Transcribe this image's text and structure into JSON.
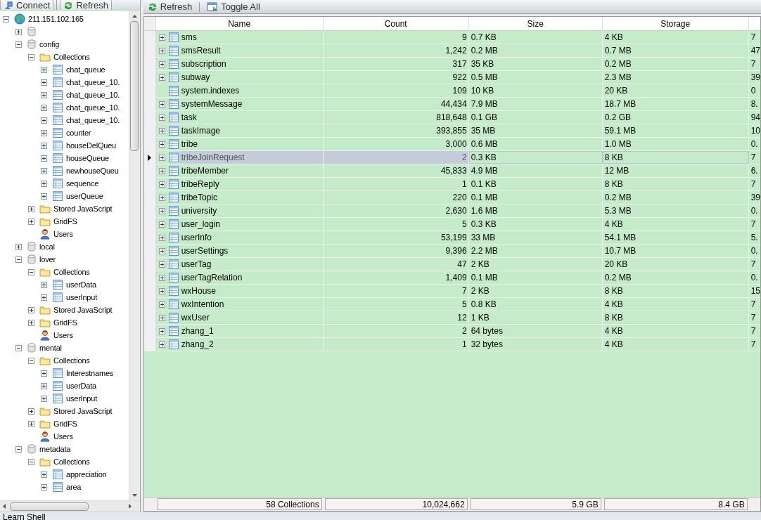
{
  "left_toolbar": {
    "buttons": [
      {
        "kind": "connect",
        "label": "Connect"
      },
      {
        "kind": "refresh",
        "label": "Refresh"
      }
    ]
  },
  "tree": [
    {
      "kind": "server",
      "label": "211.151.102.165",
      "expanded": true,
      "children": [
        {
          "kind": "db",
          "expanded": false
        },
        {
          "kind": "db",
          "label": "config",
          "expanded": true,
          "children": [
            {
              "kind": "folder",
              "label": "Collections",
              "expanded": true,
              "children": [
                {
                  "kind": "collection",
                  "label": "chat_queue",
                  "expanded": false
                },
                {
                  "kind": "collection",
                  "label": "chat_queue_10.",
                  "expanded": false
                },
                {
                  "kind": "collection",
                  "label": "chat_queue_10.",
                  "expanded": false
                },
                {
                  "kind": "collection",
                  "label": "chat_queue_10.",
                  "expanded": false
                },
                {
                  "kind": "collection",
                  "label": "chat_queue_10.",
                  "expanded": false
                },
                {
                  "kind": "collection",
                  "label": "counter",
                  "expanded": false
                },
                {
                  "kind": "collection",
                  "label": "houseDelQueu",
                  "expanded": false
                },
                {
                  "kind": "collection",
                  "label": "houseQueue",
                  "expanded": false
                },
                {
                  "kind": "collection",
                  "label": "newhouseQueu",
                  "expanded": false
                },
                {
                  "kind": "collection",
                  "label": "sequence",
                  "expanded": false
                },
                {
                  "kind": "collection",
                  "label": "userQueue",
                  "expanded": false
                }
              ]
            },
            {
              "kind": "folder",
              "label": "Stored JavaScript",
              "expanded": false
            },
            {
              "kind": "folder",
              "label": "GridFS",
              "expanded": false
            },
            {
              "kind": "users",
              "label": "Users"
            }
          ]
        },
        {
          "kind": "db",
          "label": "local",
          "expanded": false
        },
        {
          "kind": "db",
          "label": "lover",
          "expanded": true,
          "children": [
            {
              "kind": "folder",
              "label": "Collections",
              "expanded": true,
              "children": [
                {
                  "kind": "collection",
                  "label": "userData",
                  "expanded": false
                },
                {
                  "kind": "collection",
                  "label": "userInput",
                  "expanded": false
                }
              ]
            },
            {
              "kind": "folder",
              "label": "Stored JavaScript",
              "expanded": false
            },
            {
              "kind": "folder",
              "label": "GridFS",
              "expanded": false
            },
            {
              "kind": "users",
              "label": "Users"
            }
          ]
        },
        {
          "kind": "db",
          "label": "mental",
          "expanded": true,
          "children": [
            {
              "kind": "folder",
              "label": "Collections",
              "expanded": true,
              "children": [
                {
                  "kind": "collection",
                  "label": "Interestnames",
                  "expanded": false
                },
                {
                  "kind": "collection",
                  "label": "userData",
                  "expanded": false
                },
                {
                  "kind": "collection",
                  "label": "userInput",
                  "expanded": false
                }
              ]
            },
            {
              "kind": "folder",
              "label": "Stored JavaScript",
              "expanded": false
            },
            {
              "kind": "folder",
              "label": "GridFS",
              "expanded": false
            },
            {
              "kind": "users",
              "label": "Users"
            }
          ]
        },
        {
          "kind": "db",
          "label": "metadata",
          "expanded": true,
          "children": [
            {
              "kind": "folder",
              "label": "Collections",
              "expanded": true,
              "children": [
                {
                  "kind": "collection",
                  "label": "appreciation",
                  "expanded": false
                },
                {
                  "kind": "collection",
                  "label": "area",
                  "expanded": false
                }
              ]
            }
          ]
        }
      ]
    }
  ],
  "right_toolbar": {
    "buttons": [
      {
        "kind": "refresh",
        "label": "Refresh"
      },
      {
        "kind": "toggle",
        "label": "Toggle All"
      }
    ]
  },
  "table": {
    "columns": [
      "Name",
      "Count",
      "Size",
      "Storage"
    ],
    "rows": [
      {
        "name": "sms",
        "count": "9",
        "size": "0.7 KB",
        "storage": "4 KB",
        "column_5": "7",
        "expandable": true,
        "selected": false
      },
      {
        "name": "smsResult",
        "count": "1,242",
        "size": "0.2 MB",
        "storage": "0.7 MB",
        "column_5": "47",
        "expandable": true,
        "selected": false
      },
      {
        "name": "subscription",
        "count": "317",
        "size": "35 KB",
        "storage": "0.2 MB",
        "column_5": "7",
        "expandable": true,
        "selected": false
      },
      {
        "name": "subway",
        "count": "922",
        "size": "0.5 MB",
        "storage": "2.3 MB",
        "column_5": "39",
        "expandable": true,
        "selected": false
      },
      {
        "name": "system.indexes",
        "count": "109",
        "size": "10 KB",
        "storage": "20 KB",
        "column_5": "0",
        "expandable": false,
        "selected": false
      },
      {
        "name": "systemMessage",
        "count": "44,434",
        "size": "7.9 MB",
        "storage": "18.7 MB",
        "column_5": "8.",
        "expandable": true,
        "selected": false
      },
      {
        "name": "task",
        "count": "818,648",
        "size": "0.1 GB",
        "storage": "0.2 GB",
        "column_5": "94",
        "expandable": true,
        "selected": false
      },
      {
        "name": "taskImage",
        "count": "393,855",
        "size": "35 MB",
        "storage": "59.1 MB",
        "column_5": "10",
        "expandable": true,
        "selected": false
      },
      {
        "name": "tribe",
        "count": "3,000",
        "size": "0.6 MB",
        "storage": "1.0 MB",
        "column_5": "0.",
        "expandable": true,
        "selected": false
      },
      {
        "name": "tribeJoinRequest",
        "count": "2",
        "size": "0.3 KB",
        "storage": "8 KB",
        "column_5": "7",
        "expandable": true,
        "selected": true
      },
      {
        "name": "tribeMember",
        "count": "45,833",
        "size": "4.9 MB",
        "storage": "12 MB",
        "column_5": "6.",
        "expandable": true,
        "selected": false
      },
      {
        "name": "tribeReply",
        "count": "1",
        "size": "0.1 KB",
        "storage": "8 KB",
        "column_5": "7",
        "expandable": true,
        "selected": false
      },
      {
        "name": "tribeTopic",
        "count": "220",
        "size": "0.1 MB",
        "storage": "0.2 MB",
        "column_5": "39",
        "expandable": true,
        "selected": false
      },
      {
        "name": "university",
        "count": "2,630",
        "size": "1.6 MB",
        "storage": "5.3 MB",
        "column_5": "0.",
        "expandable": true,
        "selected": false
      },
      {
        "name": "user_login",
        "count": "5",
        "size": "0.3 KB",
        "storage": "4 KB",
        "column_5": "7",
        "expandable": true,
        "selected": false
      },
      {
        "name": "userInfo",
        "count": "53,199",
        "size": "33 MB",
        "storage": "54.1 MB",
        "column_5": "5.",
        "expandable": true,
        "selected": false
      },
      {
        "name": "userSettings",
        "count": "9,396",
        "size": "2.2 MB",
        "storage": "10.7 MB",
        "column_5": "0.",
        "expandable": true,
        "selected": false
      },
      {
        "name": "userTag",
        "count": "47",
        "size": "2 KB",
        "storage": "20 KB",
        "column_5": "7",
        "expandable": true,
        "selected": false
      },
      {
        "name": "userTagRelation",
        "count": "1,409",
        "size": "0.1 MB",
        "storage": "0.2 MB",
        "column_5": "0.",
        "expandable": true,
        "selected": false
      },
      {
        "name": "wxHouse",
        "count": "7",
        "size": "2 KB",
        "storage": "8 KB",
        "column_5": "15",
        "expandable": true,
        "selected": false
      },
      {
        "name": "wxIntention",
        "count": "5",
        "size": "0.8 KB",
        "storage": "4 KB",
        "column_5": "7",
        "expandable": true,
        "selected": false
      },
      {
        "name": "wxUser",
        "count": "12",
        "size": "1 KB",
        "storage": "8 KB",
        "column_5": "7",
        "expandable": true,
        "selected": false
      },
      {
        "name": "zhang_1",
        "count": "2",
        "size": "64 bytes",
        "storage": "4 KB",
        "column_5": "7",
        "expandable": true,
        "selected": false
      },
      {
        "name": "zhang_2",
        "count": "1",
        "size": "32 bytes",
        "storage": "4 KB",
        "column_5": "7",
        "expandable": true,
        "selected": false
      }
    ],
    "totals": {
      "name": "58 Collections",
      "count": "10,024,662",
      "size": "5.9 GB",
      "storage": "8.4 GB"
    }
  },
  "status_bar": {
    "label": "Learn Shell"
  }
}
